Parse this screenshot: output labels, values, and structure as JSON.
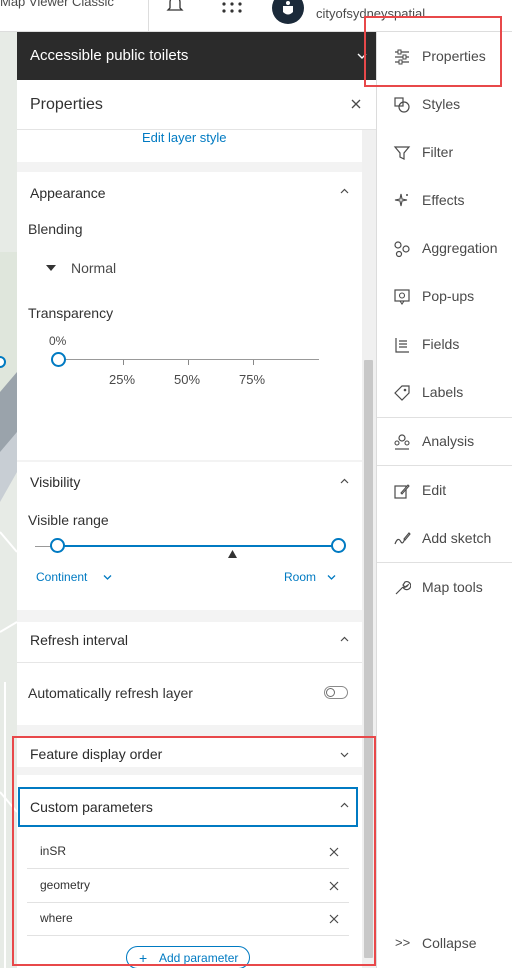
{
  "topbar": {
    "app_name": "Map Viewer Classic",
    "username": "cityofsydneyspatial"
  },
  "layer": {
    "title": "Accessible public toilets"
  },
  "properties_panel": {
    "title": "Properties",
    "edit_layer_style": "Edit layer style",
    "appearance": {
      "title": "Appearance",
      "blending_label": "Blending",
      "blending_value": "Normal",
      "transparency_label": "Transparency",
      "transparency_value": "0%",
      "transparency_ticks": [
        "25%",
        "50%",
        "75%"
      ]
    },
    "visibility": {
      "title": "Visibility",
      "visible_range_label": "Visible range",
      "min_scale": "Continent",
      "max_scale": "Room"
    },
    "refresh": {
      "title": "Refresh interval",
      "auto_refresh_label": "Automatically refresh layer",
      "auto_refresh_on": false
    },
    "feature_display_order": {
      "title": "Feature display order"
    },
    "custom_parameters": {
      "title": "Custom parameters",
      "params": [
        "inSR",
        "geometry",
        "where"
      ],
      "add_label": "Add parameter"
    }
  },
  "rail": {
    "items": [
      {
        "label": "Properties",
        "icon": "sliders-icon"
      },
      {
        "label": "Styles",
        "icon": "styles-icon"
      },
      {
        "label": "Filter",
        "icon": "filter-icon"
      },
      {
        "label": "Effects",
        "icon": "effects-icon"
      },
      {
        "label": "Aggregation",
        "icon": "aggregation-icon"
      },
      {
        "label": "Pop-ups",
        "icon": "popup-icon"
      },
      {
        "label": "Fields",
        "icon": "fields-icon"
      },
      {
        "label": "Labels",
        "icon": "labels-icon"
      },
      {
        "label": "Analysis",
        "icon": "analysis-icon"
      },
      {
        "label": "Edit",
        "icon": "edit-icon"
      },
      {
        "label": "Add sketch",
        "icon": "sketch-icon"
      },
      {
        "label": "Map tools",
        "icon": "wrench-icon"
      }
    ],
    "collapse_label": "Collapse"
  },
  "colors": {
    "accent": "#007ac2",
    "highlight_box": "#e8484a",
    "header_dark": "#2b2b2b"
  }
}
